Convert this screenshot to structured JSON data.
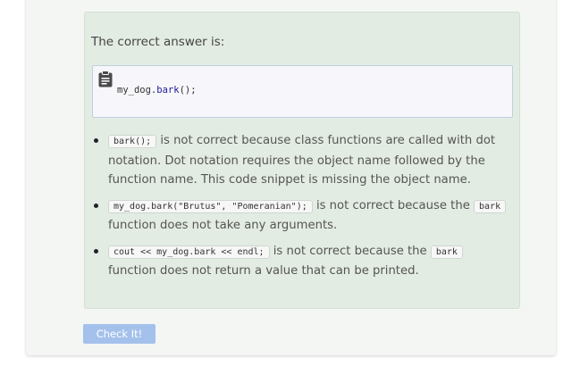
{
  "feedback": {
    "intro": "The correct answer is:",
    "code": {
      "object": "my_dog.",
      "method": "bark",
      "rest": "();"
    },
    "items": [
      {
        "code": "bark();",
        "text": " is not correct because class functions are called with dot notation. Dot notation requires the object name followed by the function name. This code snippet is missing the object name."
      },
      {
        "code": "my_dog.bark(\"Brutus\", \"Pomeranian\");",
        "text1": " is not correct because the ",
        "code2": "bark",
        "text2": " function does not take any arguments."
      },
      {
        "code": "cout << my_dog.bark << endl;",
        "text1": " is not correct because the ",
        "code2": "bark",
        "text2": " function does not return a value that can be printed."
      }
    ]
  },
  "check_button": {
    "label": "Check It!"
  },
  "colors": {
    "feedback_bg": "#e3ece2",
    "button_bg": "#a4c1ec",
    "method_color": "#1a1a9a"
  }
}
